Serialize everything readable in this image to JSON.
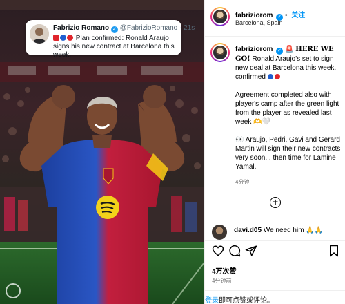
{
  "tweet": {
    "name": "Fabrizio Romano",
    "handle": "@FabrizioRomano · 21s",
    "body": "Plan confirmed: Ronald Araujo signs his new contract at Barcelona this week."
  },
  "header": {
    "username": "fabriziorom",
    "follow_label": "关注",
    "location": "Barcelona, Spain"
  },
  "caption": {
    "username": "fabriziorom",
    "headline": "HERE WE GO!",
    "para1": "Ronald Araujo's set to sign new deal at Barcelona this week, confirmed",
    "para2": "Agreement completed also with player's camp after the green light from the player as revealed last week",
    "para2_tail": "🤍",
    "para2_tail_prefix": "🫶",
    "para3_lead": "👀",
    "para3": "Araujo, Pedri, Gavi and Gerard Martin will sign their new contracts very soon... then time for Lamine Yamal.",
    "time": "4分钟"
  },
  "comment": {
    "username": "davi.d05",
    "text": "We need him",
    "emoji": "🙏🙏"
  },
  "engagement": {
    "likes": "4万次赞",
    "time": "4分钟前"
  },
  "login_prompt": {
    "link": "登录",
    "rest": "即可点赞或评论。"
  },
  "icons": [
    "heart-icon",
    "comment-icon",
    "share-icon",
    "bookmark-icon",
    "add-comment-icon",
    "verified-icon"
  ],
  "colors": {
    "accent_blue": "#0095f6",
    "barca_blue": "#1f4fb8",
    "barca_red": "#c8223a",
    "spotify_yellow": "#f2d21a"
  }
}
